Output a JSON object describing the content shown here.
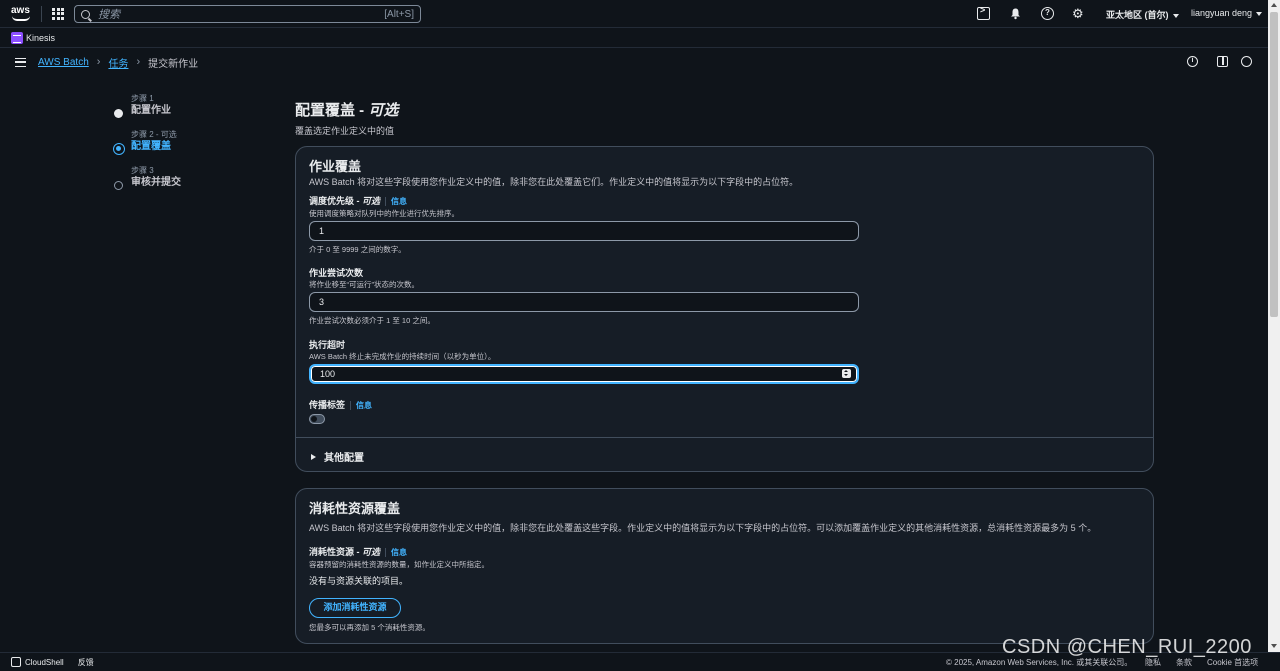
{
  "topnav": {
    "logo": "aws",
    "search_placeholder": "搜索",
    "search_shortcut": "[Alt+S]",
    "region": "亚太地区 (首尔)",
    "user": "liangyuan deng"
  },
  "service": {
    "name": "Kinesis"
  },
  "breadcrumb": {
    "items": [
      "AWS Batch",
      "任务"
    ],
    "current": "提交新作业"
  },
  "steps": [
    {
      "label": "步骤 1",
      "title": "配置作业"
    },
    {
      "label": "步骤 2 - 可选",
      "title": "配置覆盖"
    },
    {
      "label": "步骤 3",
      "title": "审核并提交"
    }
  ],
  "page": {
    "title": "配置覆盖 - ",
    "title_optional": "可选",
    "subtitle": "覆盖选定作业定义中的值"
  },
  "job_override": {
    "title": "作业覆盖",
    "description": "AWS Batch 将对这些字段使用您作业定义中的值，除非您在此处覆盖它们。作业定义中的值将显示为以下字段中的占位符。",
    "priority": {
      "label": "调度优先级 - ",
      "label_optional": "可选",
      "info": "信息",
      "desc": "使用调度策略对队列中的作业进行优先排序。",
      "value": "1",
      "hint": "介于 0 至 9999 之间的数字。"
    },
    "attempts": {
      "label": "作业尝试次数",
      "desc": "将作业移至“可运行”状态的次数。",
      "value": "3",
      "hint": "作业尝试次数必须介于 1 至 10 之间。"
    },
    "timeout": {
      "label": "执行超时",
      "desc": "AWS Batch 终止未完成作业的持续时间（以秒为单位）。",
      "value": "100"
    },
    "propagate_tags": {
      "label": "传播标签",
      "info": "信息",
      "enabled": false
    },
    "more_config": "其他配置"
  },
  "consumable_override": {
    "title": "消耗性资源覆盖",
    "description": "AWS Batch 将对这些字段使用您作业定义中的值，除非您在此处覆盖这些字段。作业定义中的值将显示为以下字段中的占位符。可以添加覆盖作业定义的其他消耗性资源，总消耗性资源最多为 5 个。",
    "field_label": "消耗性资源 - ",
    "field_optional": "可选",
    "info": "信息",
    "field_desc": "容器预留的消耗性资源的数量，如作业定义中所指定。",
    "empty": "没有与资源关联的项目。",
    "add_button": "添加消耗性资源",
    "add_hint": "您最多可以再添加 5 个消耗性资源。"
  },
  "footer": {
    "cloudshell": "CloudShell",
    "feedback": "反馈",
    "copyright": "© 2025, Amazon Web Services, Inc. 或其关联公司。",
    "privacy": "隐私",
    "terms": "条款",
    "cookie": "Cookie 首选项"
  },
  "watermark": "CSDN @CHEN_RUI_2200",
  "colors": {
    "accent": "#42b4ff",
    "background": "#0f141a",
    "card": "#161d26"
  }
}
